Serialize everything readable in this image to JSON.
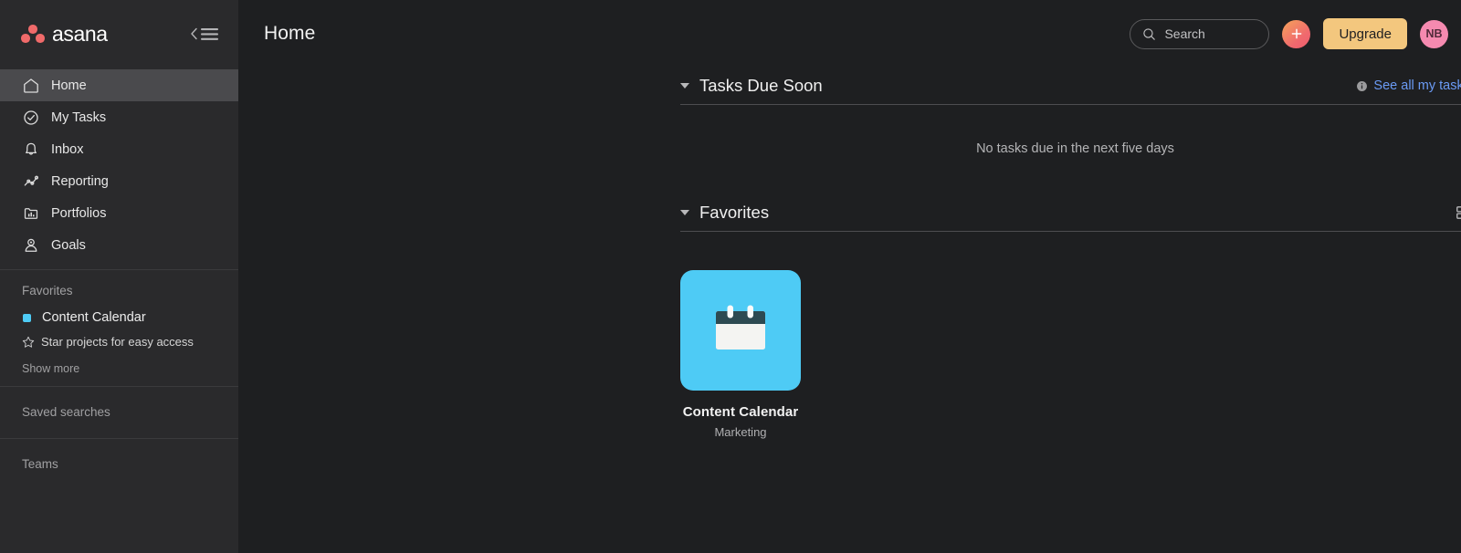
{
  "sidebar": {
    "logo_text": "asana",
    "collapse_icon": "chevron-left-menu-icon",
    "nav_items": [
      {
        "label": "Home",
        "icon": "home-icon",
        "active": true
      },
      {
        "label": "My Tasks",
        "icon": "check-circle-icon",
        "active": false
      },
      {
        "label": "Inbox",
        "icon": "bell-icon",
        "active": false
      },
      {
        "label": "Reporting",
        "icon": "line-chart-icon",
        "active": false
      },
      {
        "label": "Portfolios",
        "icon": "folder-chart-icon",
        "active": false
      },
      {
        "label": "Goals",
        "icon": "goal-person-icon",
        "active": false
      }
    ],
    "favorites_title": "Favorites",
    "favorite_items": [
      {
        "label": "Content Calendar",
        "color": "#4ecbf5"
      }
    ],
    "star_hint": "Star projects for easy access",
    "star_hint_icon": "star-outline-icon",
    "show_more": "Show more",
    "saved_searches_title": "Saved searches",
    "teams_title": "Teams"
  },
  "topbar": {
    "page_title": "Home",
    "search_placeholder": "Search",
    "search_icon": "search-icon",
    "plus_label": "+",
    "plus_icon": "plus-icon",
    "upgrade_label": "Upgrade",
    "avatar_initials": "NB"
  },
  "tasks_section": {
    "title": "Tasks Due Soon",
    "link_label": "See all my tasks",
    "link_icon": "info-circle-icon",
    "caret_icon": "caret-down-icon",
    "empty_message": "No tasks due in the next five days"
  },
  "favorites_section": {
    "title": "Favorites",
    "caret_icon": "caret-down-icon",
    "grid_icon": "grid-view-icon",
    "cards": [
      {
        "name": "Content Calendar",
        "subtitle": "Marketing",
        "tile_color": "#4ecbf5",
        "icon": "calendar-icon"
      }
    ]
  },
  "colors": {
    "sidebar_bg": "#2a2a2c",
    "main_bg": "#1e1f21",
    "active_nav": "#4a4a4d",
    "brand_coral": "#f06a6a",
    "accent_cyan": "#4ecbf5",
    "upgrade_yellow": "#f3c77e",
    "avatar_pink": "#f58ab0",
    "link_blue": "#6b9bf5"
  }
}
